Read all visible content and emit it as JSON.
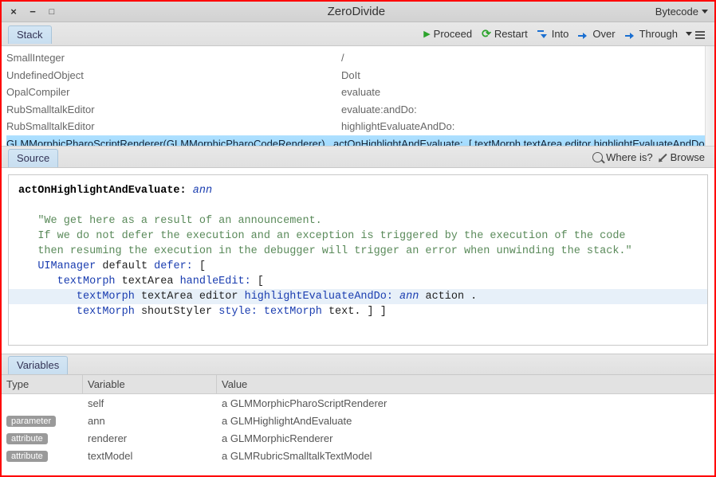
{
  "window": {
    "title": "ZeroDivide",
    "mode": "Bytecode"
  },
  "toolbar": {
    "stack_tab": "Stack",
    "proceed": "Proceed",
    "restart": "Restart",
    "into": "Into",
    "over": "Over",
    "through": "Through"
  },
  "stack": [
    {
      "class": "SmallInteger",
      "method": "/"
    },
    {
      "class": "UndefinedObject",
      "method": "DoIt"
    },
    {
      "class": "OpalCompiler",
      "method": "evaluate"
    },
    {
      "class": "RubSmalltalkEditor",
      "method": "evaluate:andDo:"
    },
    {
      "class": "RubSmalltalkEditor",
      "method": "highlightEvaluateAndDo:"
    },
    {
      "class": "GLMMorphicPharoScriptRenderer(GLMMorphicPharoCodeRenderer)",
      "method": "actOnHighlightAndEvaluate:",
      "extra": "[ textMorph textArea editor highlightEvaluateAndDo: an"
    }
  ],
  "source_bar": {
    "tab": "Source",
    "whereis": "Where is?",
    "browse": "Browse"
  },
  "source": {
    "selector": "actOnHighlightAndEvaluate:",
    "arg": "ann",
    "comment1": "\"We get here as a result of an announcement.",
    "comment2": "If we do not defer the execution and an exception is triggered by the execution of the code",
    "comment3": "then resuming the execution in the debugger will trigger an error when unwinding the stack.\"",
    "l1a": "UIManager",
    "l1b": "default",
    "l1c": "defer:",
    "l2a": "textMorph",
    "l2b": "textArea",
    "l2c": "handleEdit:",
    "l3a": "textMorph",
    "l3b": "textArea",
    "l3c": "editor",
    "l3d": "highlightEvaluateAndDo:",
    "l3e": "ann",
    "l3f": "action",
    "l4a": "textMorph",
    "l4b": "shoutStyler",
    "l4c": "style:",
    "l4d": "textMorph",
    "l4e": "text."
  },
  "vars_bar": {
    "tab": "Variables"
  },
  "var_headers": {
    "type": "Type",
    "variable": "Variable",
    "value": "Value"
  },
  "variables": [
    {
      "type": "",
      "name": "self",
      "value": "a GLMMorphicPharoScriptRenderer"
    },
    {
      "type": "parameter",
      "name": "ann",
      "value": "a GLMHighlightAndEvaluate"
    },
    {
      "type": "attribute",
      "name": "renderer",
      "value": "a GLMMorphicRenderer"
    },
    {
      "type": "attribute",
      "name": "textModel",
      "value": "a GLMRubricSmalltalkTextModel"
    }
  ]
}
